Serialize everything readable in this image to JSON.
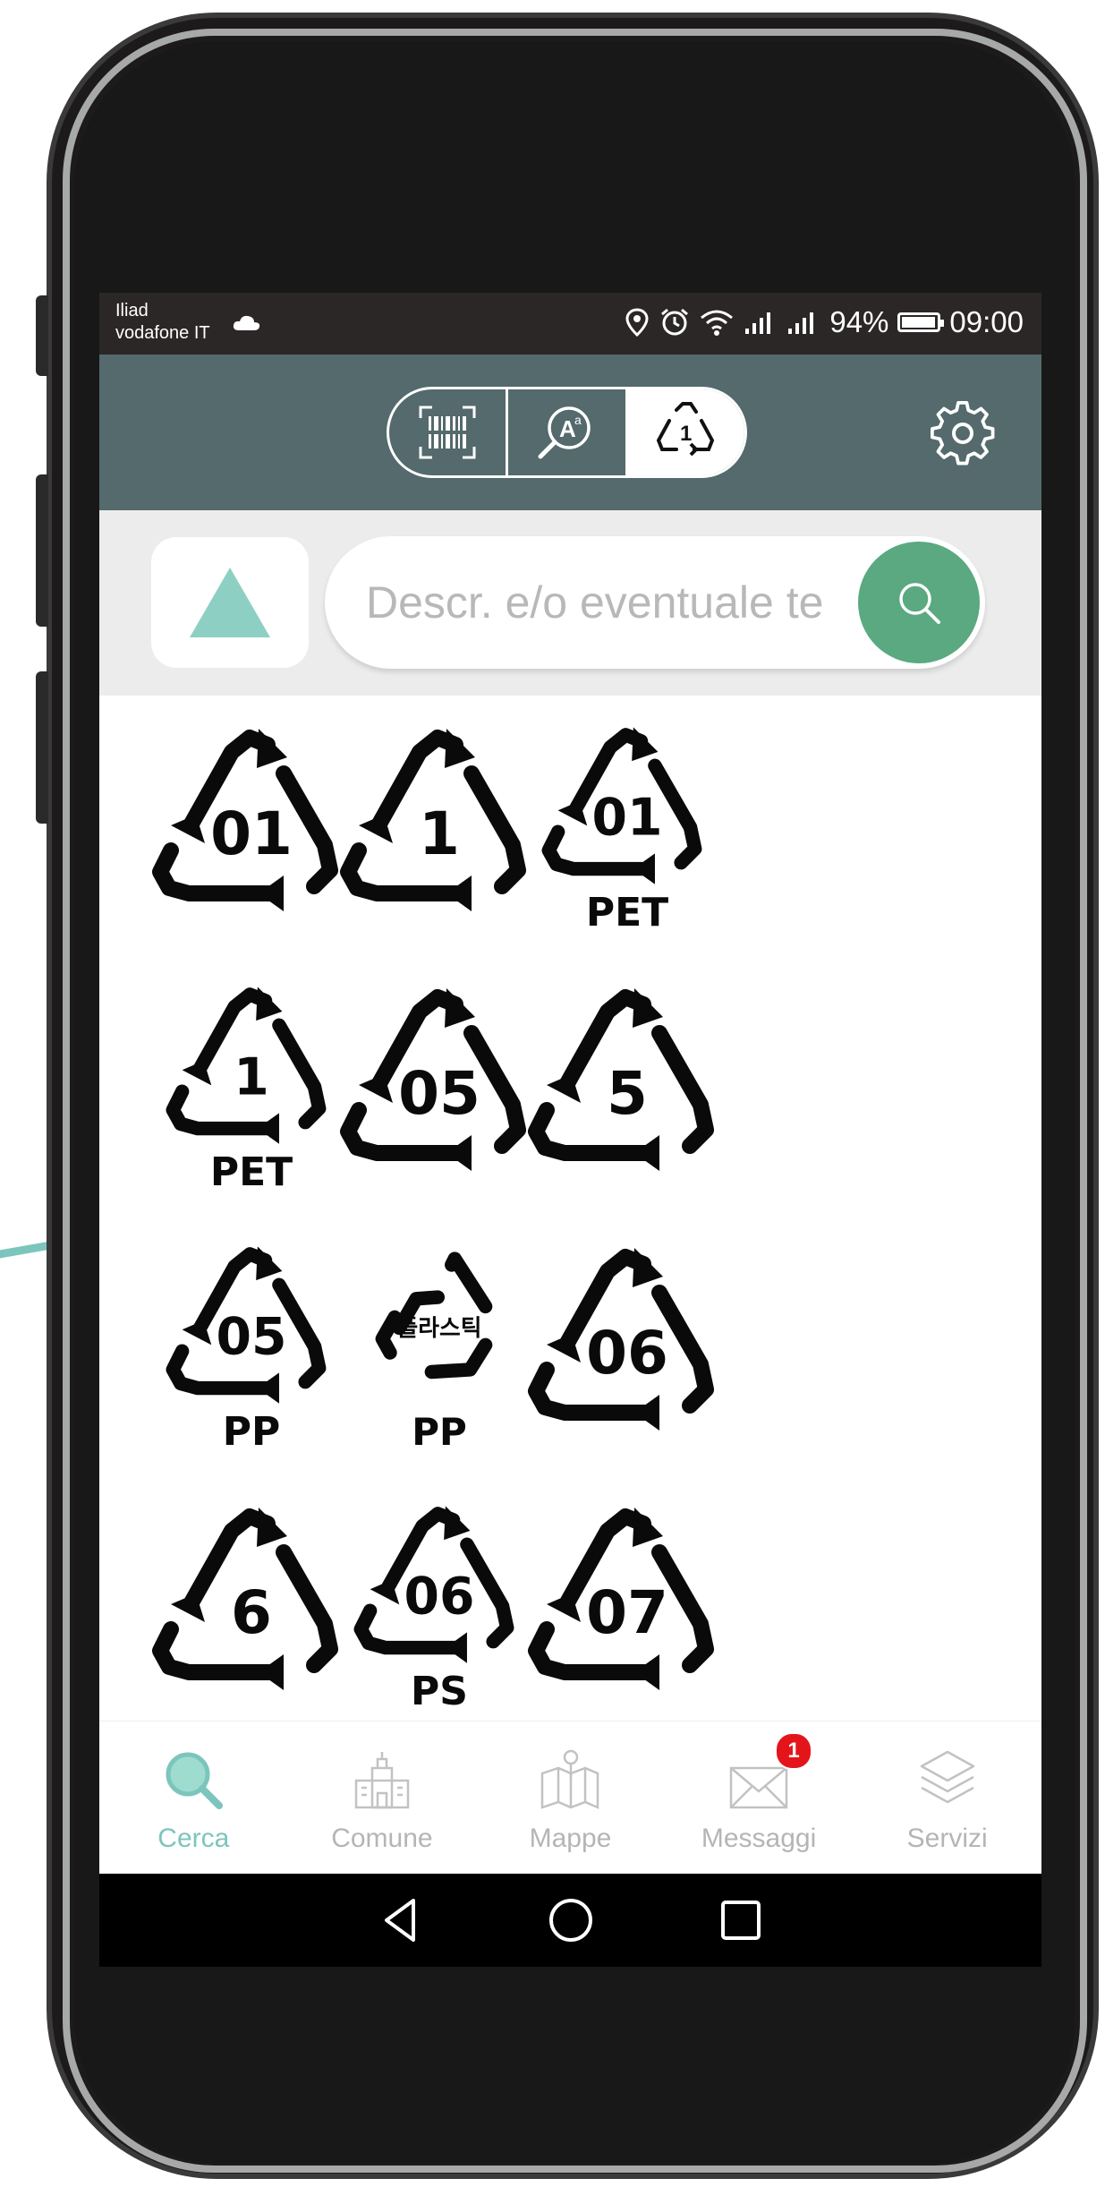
{
  "status_bar": {
    "carrier_line1": "Iliad",
    "carrier_line2": "vodafone IT",
    "battery": "94%",
    "time": "09:00"
  },
  "header": {
    "segments": [
      "barcode-scan-icon",
      "text-search-icon",
      "recycling-code-icon"
    ],
    "selected_segment_index": 2,
    "recycling_segment_label": "1"
  },
  "search": {
    "placeholder": "Descr. e/o eventuale testo",
    "value": "Descr. e/o eventuale te"
  },
  "symbols": [
    {
      "code": "01",
      "sub": ""
    },
    {
      "code": "1",
      "sub": ""
    },
    {
      "code": "01",
      "sub": "PET"
    },
    {
      "code": "1",
      "sub": "PET"
    },
    {
      "code": "05",
      "sub": ""
    },
    {
      "code": "5",
      "sub": ""
    },
    {
      "code": "05",
      "sub": "PP"
    },
    {
      "code": "플라스틱",
      "sub": "PP"
    },
    {
      "code": "06",
      "sub": ""
    },
    {
      "code": "6",
      "sub": ""
    },
    {
      "code": "06",
      "sub": "PS"
    },
    {
      "code": "07",
      "sub": ""
    }
  ],
  "bottom_nav": {
    "items": [
      {
        "label": "Cerca",
        "icon": "search-icon",
        "active": true
      },
      {
        "label": "Comune",
        "icon": "town-hall-icon",
        "active": false
      },
      {
        "label": "Mappe",
        "icon": "map-icon",
        "active": false
      },
      {
        "label": "Messaggi",
        "icon": "mail-icon",
        "active": false,
        "badge": "1"
      },
      {
        "label": "Servizi",
        "icon": "layers-icon",
        "active": false
      }
    ]
  },
  "colors": {
    "accent_teal": "#7cc5bd",
    "appbar": "#546a6c",
    "search_button": "#5aa980",
    "badge": "#e3151b"
  }
}
